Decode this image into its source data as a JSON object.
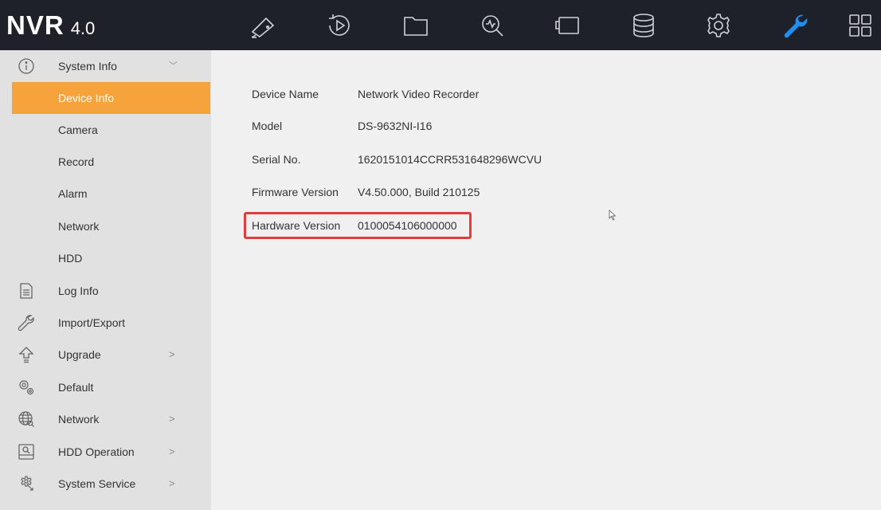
{
  "header": {
    "logo_main": "NVR",
    "logo_version": "4.0",
    "icons": [
      {
        "name": "live-view-camera-icon"
      },
      {
        "name": "playback-icon"
      },
      {
        "name": "file-management-icon"
      },
      {
        "name": "smart-analysis-icon"
      },
      {
        "name": "camera-config-icon"
      },
      {
        "name": "storage-icon"
      },
      {
        "name": "configuration-gear-icon"
      },
      {
        "name": "maintenance-wrench-icon"
      },
      {
        "name": "menu-grid-icon"
      }
    ],
    "active_icon_color": "#1e8ef0"
  },
  "sidebar": {
    "system_info": {
      "label": "System Info",
      "arrow": "﹀"
    },
    "sub_items": [
      {
        "label": "Device Info"
      },
      {
        "label": "Camera"
      },
      {
        "label": "Record"
      },
      {
        "label": "Alarm"
      },
      {
        "label": "Network"
      },
      {
        "label": "HDD"
      }
    ],
    "items": [
      {
        "label": "Log Info",
        "arrow": ""
      },
      {
        "label": "Import/Export",
        "arrow": ""
      },
      {
        "label": "Upgrade",
        "arrow": ">"
      },
      {
        "label": "Default",
        "arrow": ""
      },
      {
        "label": "Network",
        "arrow": ">"
      },
      {
        "label": "HDD Operation",
        "arrow": ">"
      },
      {
        "label": "System Service",
        "arrow": ">"
      }
    ],
    "active_color": "#f5a33a"
  },
  "device_info": [
    {
      "key": "Device Name",
      "value": "Network Video Recorder"
    },
    {
      "key": "Model",
      "value": "DS-9632NI-I16"
    },
    {
      "key": "Serial No.",
      "value": "1620151014CCRR531648296WCVU"
    },
    {
      "key": "Firmware Version",
      "value": "V4.50.000, Build 210125"
    },
    {
      "key": "Hardware Version",
      "value": "0100054106000000"
    }
  ],
  "highlight_color": "#e23c3c"
}
